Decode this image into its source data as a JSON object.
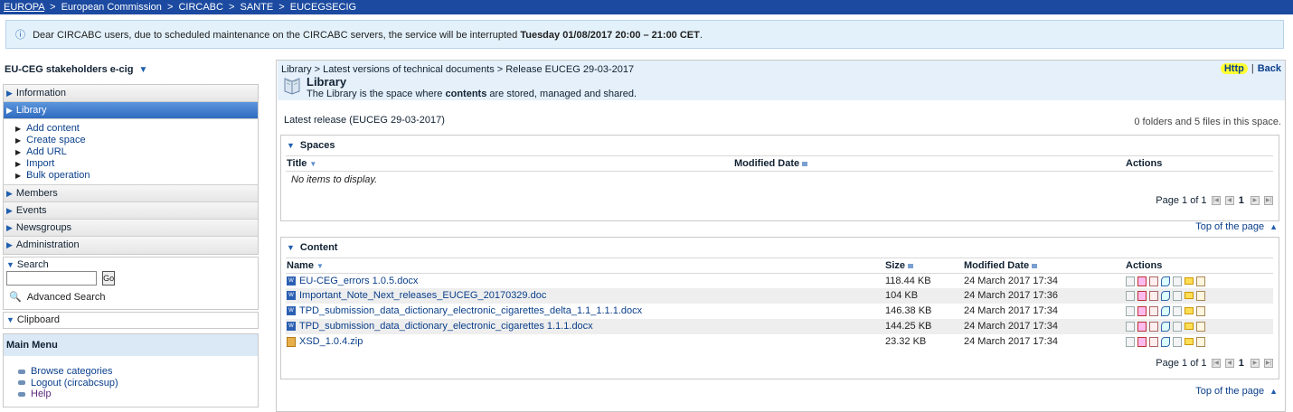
{
  "topbar": {
    "europa": "EUROPA",
    "commission": "European Commission",
    "circabc": "CIRCABC",
    "sante": "SANTE",
    "group": "EUCEGSECIG",
    "sep": ">"
  },
  "notice": {
    "prefix": "Dear CIRCABC users, due to scheduled maintenance on the CIRCABC servers, the service will be interrupted",
    "when": "Tuesday 01/08/2017 20:00 – 21:00 CET",
    "suffix": "."
  },
  "left": {
    "space_title": "EU-CEG stakeholders e-cig",
    "nav": {
      "information": "Information",
      "library": "Library",
      "members": "Members",
      "events": "Events",
      "newsgroups": "Newsgroups",
      "administration": "Administration"
    },
    "library_sub": [
      "Add content",
      "Create space",
      "Add URL",
      "Import",
      "Bulk operation"
    ],
    "search": {
      "title": "Search",
      "value": "",
      "go": "Go",
      "advanced": "Advanced Search"
    },
    "clipboard": "Clipboard",
    "main_menu": {
      "title": "Main Menu",
      "items": [
        "Browse categories",
        "Logout (circabcsup)",
        "Help"
      ]
    }
  },
  "library": {
    "crumbs": "Library > Latest versions of technical documents > Release EUCEG 29-03-2017",
    "http": "Http",
    "pipe": "|",
    "back": "Back",
    "title": "Library",
    "desc_pre": "The Library is the space where",
    "desc_bold": "contents",
    "desc_post": "are stored, managed and shared.",
    "latest": "Latest release (EUCEG 29-03-2017)",
    "count": "0 folders and 5 files in this space."
  },
  "spaces": {
    "title": "Spaces",
    "col_title": "Title",
    "col_modified": "Modified Date",
    "col_actions": "Actions",
    "empty": "No items to display.",
    "pager_text": "Page 1 of 1",
    "pager_current": "1",
    "top": "Top of the page"
  },
  "content": {
    "title": "Content",
    "col_name": "Name",
    "col_size": "Size",
    "col_modified": "Modified Date",
    "col_actions": "Actions",
    "rows": [
      {
        "name": "EU-CEG_errors 1.0.5.docx",
        "size": "118.44 KB",
        "modified": "24 March 2017 17:34"
      },
      {
        "name": "Important_Note_Next_releases_EUCEG_20170329.doc",
        "size": "104 KB",
        "modified": "24 March 2017 17:36"
      },
      {
        "name": "TPD_submission_data_dictionary_electronic_cigarettes_delta_1.1_1.1.1.docx",
        "size": "146.38 KB",
        "modified": "24 March 2017 17:34"
      },
      {
        "name": "TPD_submission_data_dictionary_electronic_cigarettes 1.1.1.docx",
        "size": "144.25 KB",
        "modified": "24 March 2017 17:34"
      },
      {
        "name": "XSD_1.0.4.zip",
        "size": "23.32 KB",
        "modified": "24 March 2017 17:34"
      }
    ],
    "pager_text": "Page 1 of 1",
    "pager_current": "1",
    "top": "Top of the page"
  },
  "icons": {
    "info": "info-icon",
    "triangle": "triangle-down-icon",
    "arrow": "arrow-right-icon",
    "search": "magnifier-icon",
    "bullet": "bullet-icon",
    "library": "library-book-icon",
    "doc": "word-document-icon",
    "zip": "zip-archive-icon",
    "up": "arrow-up-icon"
  },
  "colors": {
    "topbar": "#1b4aa0",
    "notice_bg": "#e3f1fb",
    "nav_active": "#2f6bc1",
    "highlight": "#ffff33",
    "link": "#0a3f8a"
  }
}
